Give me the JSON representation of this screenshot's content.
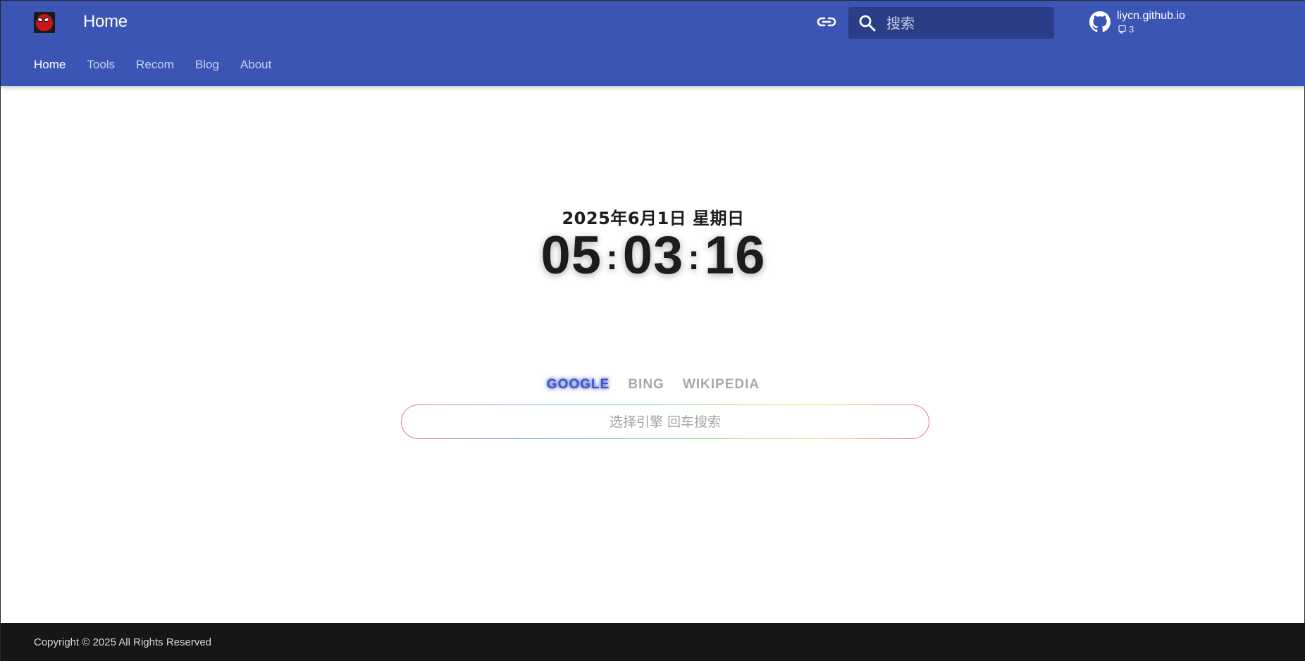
{
  "header": {
    "title": "Home",
    "nav": [
      {
        "label": "Home",
        "active": true
      },
      {
        "label": "Tools",
        "active": false
      },
      {
        "label": "Recom",
        "active": false
      },
      {
        "label": "Blog",
        "active": false
      },
      {
        "label": "About",
        "active": false
      }
    ],
    "search_placeholder": "搜索",
    "repo": {
      "name": "liycn.github.io",
      "count": "3"
    },
    "icons": [
      "logo-avatar",
      "link-icon",
      "search-icon",
      "github-icon",
      "repo-icon"
    ]
  },
  "main": {
    "date": "2025年6月1日 星期日",
    "clock": {
      "hours": "05",
      "minutes": "03",
      "seconds": "16",
      "separator": ":"
    },
    "engines": [
      {
        "label": "GOOGLE",
        "active": true
      },
      {
        "label": "BING",
        "active": false
      },
      {
        "label": "WIKIPEDIA",
        "active": false
      }
    ],
    "search_placeholder": "选择引擎 回车搜索"
  },
  "footer": {
    "copyright": "Copyright © 2025 All Rights Reserved"
  },
  "colors": {
    "header_bg": "#3b55b4",
    "search_bg": "#2b3d87",
    "active_engine": "#3d58c4",
    "footer_bg": "#161616"
  }
}
